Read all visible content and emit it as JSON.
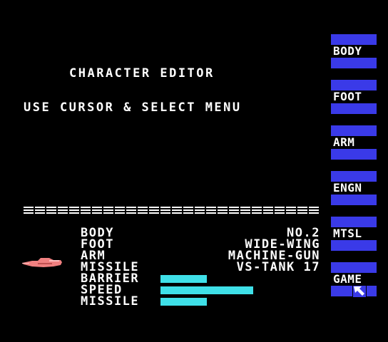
{
  "screen": {
    "title": "CHARACTER EDITOR",
    "subtitle": "USE CURSOR & SELECT MENU",
    "separator": "==========================="
  },
  "menu": {
    "items": [
      {
        "label": "BODY"
      },
      {
        "label": "FOOT"
      },
      {
        "label": "ARM"
      },
      {
        "label": "ENGN"
      },
      {
        "label": "MTSL"
      },
      {
        "label": "GAME"
      }
    ],
    "selected": "GAME",
    "colors": {
      "band": "#3a3ae8"
    }
  },
  "parts": {
    "body": {
      "label": "BODY",
      "value": "NO.2"
    },
    "foot": {
      "label": "FOOT",
      "value": "WIDE-WING"
    },
    "arm": {
      "label": "ARM",
      "value": "MACHINE-GUN"
    },
    "missile": {
      "label": "MISSILE",
      "value": "VS-TANK 17"
    }
  },
  "stats": {
    "barrier": {
      "label": "BARRIER",
      "level": 0.29
    },
    "speed": {
      "label": "SPEED",
      "level": 0.58
    },
    "missile": {
      "label": "MISSILE",
      "level": 0.29
    },
    "bar_color": "#3fe0e8"
  },
  "icons": {
    "ship": "ship-sprite-icon",
    "cursor": "arrow-cursor-icon"
  }
}
